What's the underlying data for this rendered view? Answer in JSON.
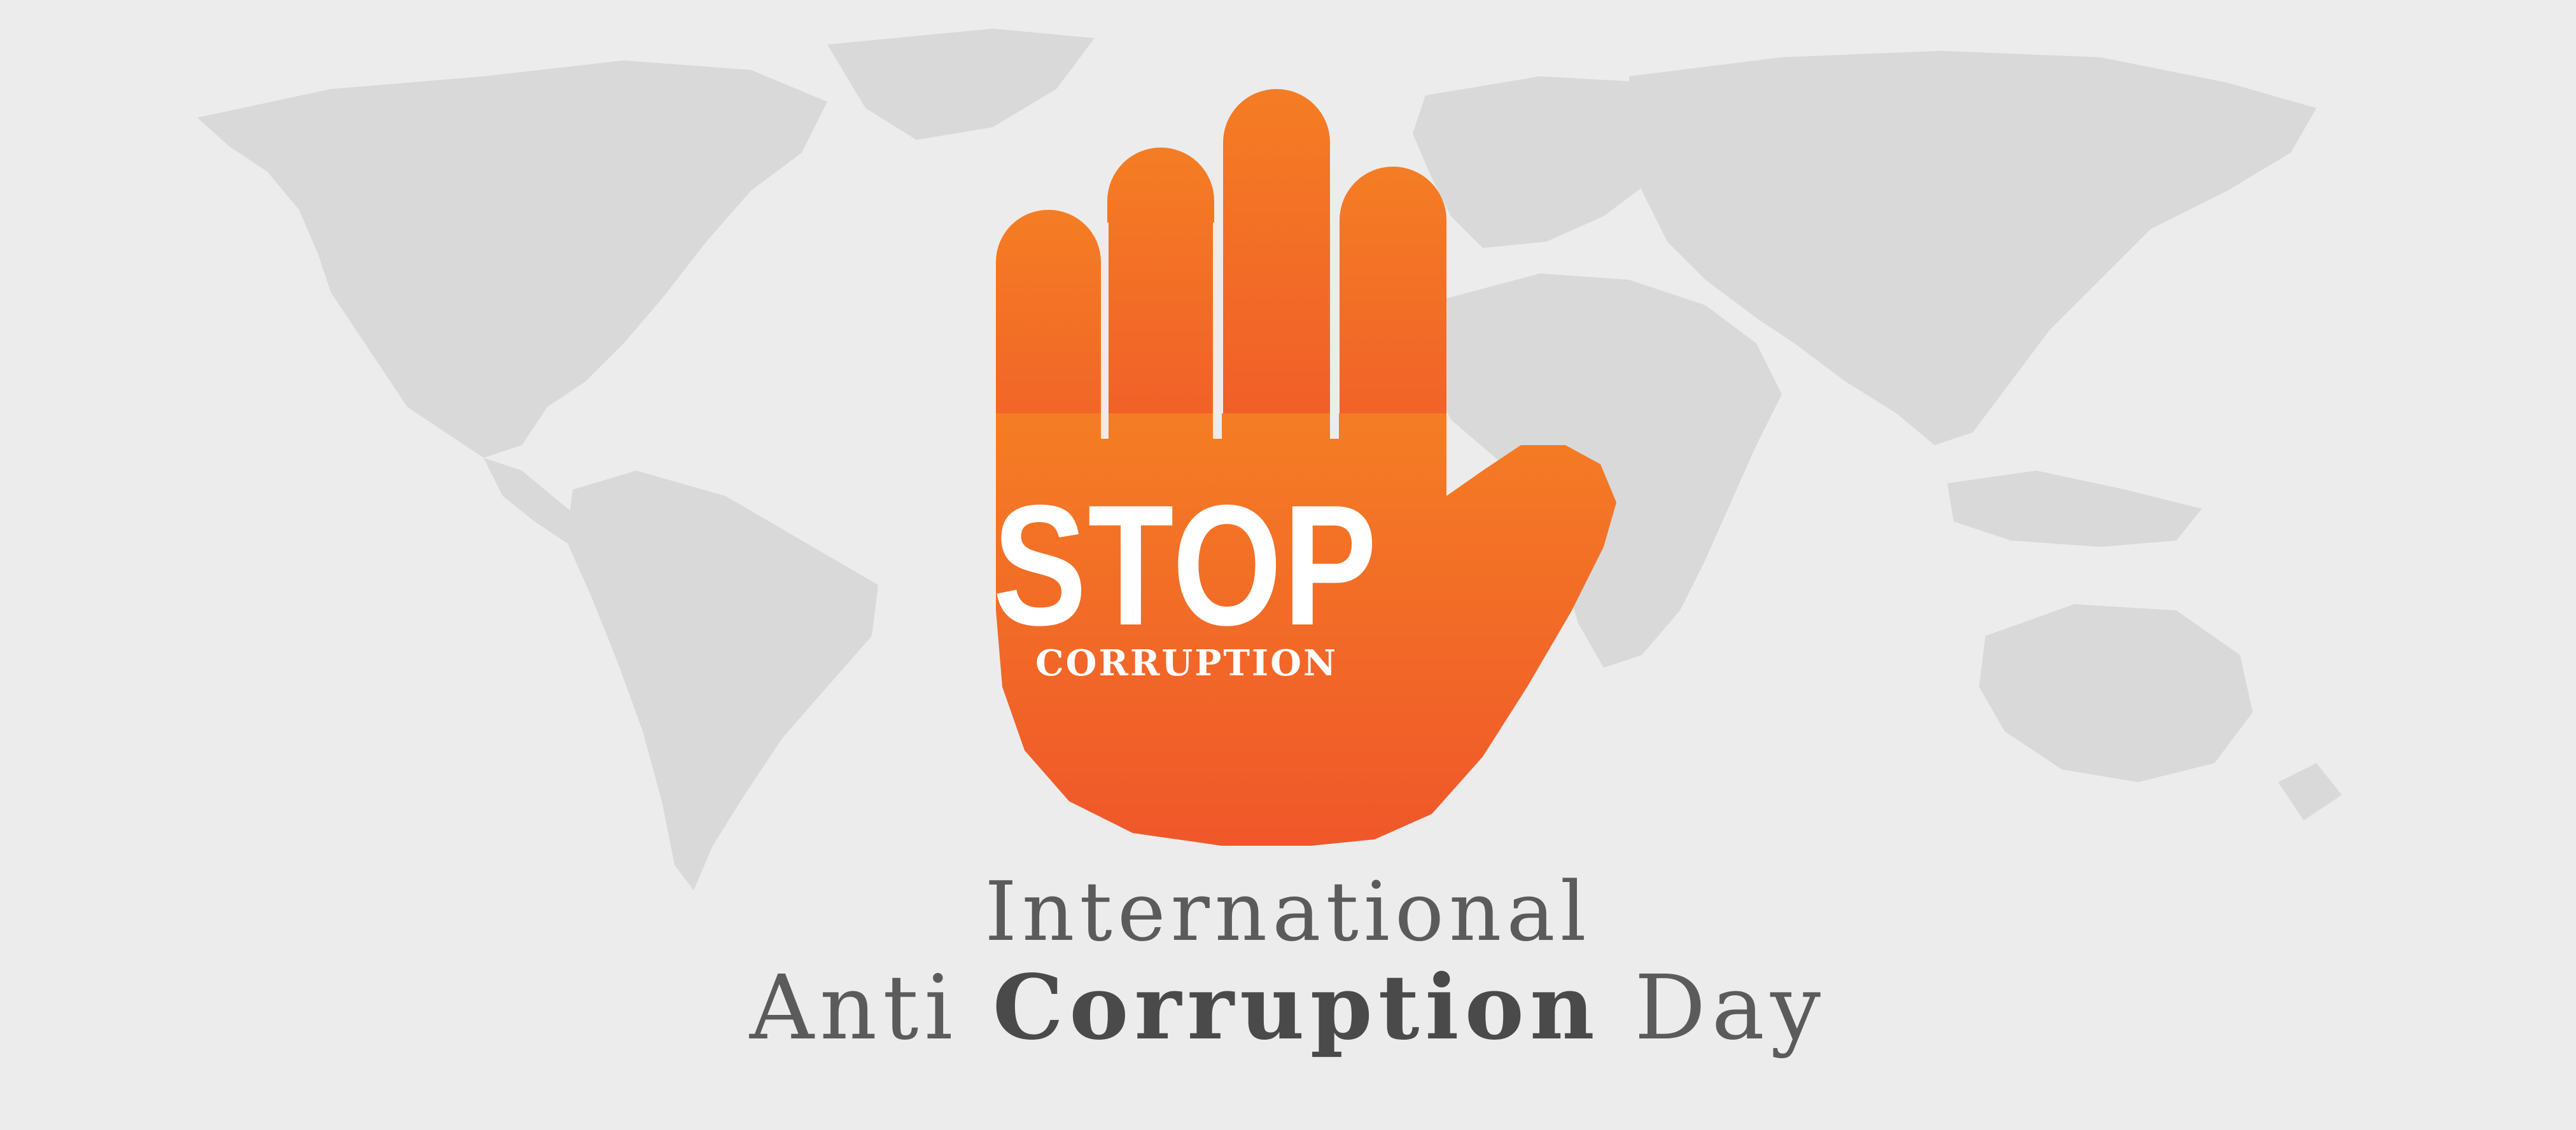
{
  "sign": {
    "stop_text": "STOP",
    "sub_text": "CORRUPTION"
  },
  "headline": {
    "line1": "International",
    "line2_part1": "Anti",
    "line2_part2": "Corruption",
    "line2_part3": "Day"
  },
  "colors": {
    "background": "#ececec",
    "map_gray": "#d9d9d9",
    "hand_top": "#f47d24",
    "hand_bottom": "#f0572a",
    "text_gray": "#5b5b5b"
  },
  "icons": {
    "hand": "stop-hand-icon",
    "map": "world-map-icon"
  }
}
